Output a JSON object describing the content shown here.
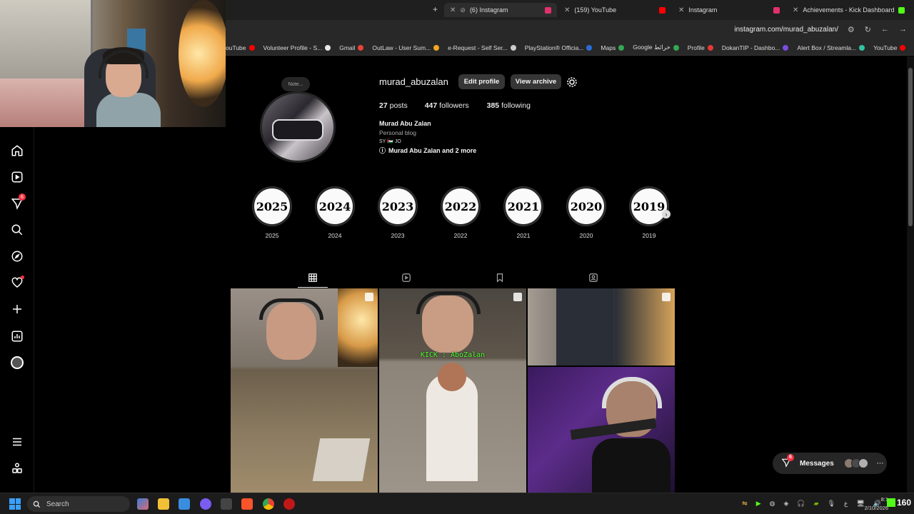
{
  "browser": {
    "tabs": [
      {
        "label": "(6) Instagram",
        "icon_color": "#e1306c"
      },
      {
        "label": "(159) YouTube",
        "icon_color": "#ff0000"
      },
      {
        "label": "Instagram",
        "icon_color": "#e1306c"
      },
      {
        "label": "Achievements - Kick Dashboard",
        "icon_color": "#53fc18"
      }
    ],
    "url": "instagram.com/murad_abuzalan/",
    "bookmarks": [
      {
        "label": "ouTube",
        "color": "#ff0000"
      },
      {
        "label": "Volunteer Profile - S...",
        "color": "#e8e8e8"
      },
      {
        "label": "Gmail",
        "color": "#ea4335"
      },
      {
        "label": "OutLaw - User Sum...",
        "color": "#f5a623"
      },
      {
        "label": "e-Request - Self Ser...",
        "color": "#cccccc"
      },
      {
        "label": "PlayStation® Officia...",
        "color": "#2b6bd6"
      },
      {
        "label": "Maps",
        "color": "#34a853"
      },
      {
        "label": "Google خرائط",
        "color": "#34a853"
      },
      {
        "label": "Profile",
        "color": "#e53935"
      },
      {
        "label": "DokanTIP - Dashbo...",
        "color": "#7b4ce0"
      },
      {
        "label": "Alert Box / Streamla...",
        "color": "#31c3a2"
      },
      {
        "label": "YouTube",
        "color": "#ff0000"
      }
    ]
  },
  "nav": {
    "notifications_badge": "6"
  },
  "profile": {
    "note": "Note...",
    "username": "murad_abuzalan",
    "edit_button": "Edit profile",
    "archive_button": "View archive",
    "posts_count": "27",
    "posts_label": "posts",
    "followers_count": "447",
    "followers_label": "followers",
    "following_count": "385",
    "following_label": "following",
    "full_name": "Murad Abu Zalan",
    "category": "Personal blog",
    "flags": "SY 🇵🇸 JO",
    "followed_by": "Murad Abu Zalan and 2 more"
  },
  "highlights": [
    {
      "cover": "2025",
      "label": "2025"
    },
    {
      "cover": "2024",
      "label": "2024"
    },
    {
      "cover": "2023",
      "label": "2023"
    },
    {
      "cover": "2022",
      "label": "2022"
    },
    {
      "cover": "2021",
      "label": "2021"
    },
    {
      "cover": "2020",
      "label": "2020"
    },
    {
      "cover": "2019",
      "label": "2019"
    }
  ],
  "posts": {
    "overlay_text": "KICK : AboZalan"
  },
  "messages": {
    "label": "Messages",
    "badge": "6"
  },
  "taskbar": {
    "search_label": "Search",
    "clock_time": "8:1",
    "clock_date": "2/10/2026",
    "viewer_count": "160"
  }
}
